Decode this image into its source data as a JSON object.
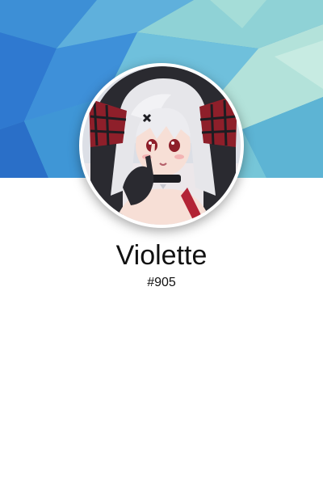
{
  "profile": {
    "display_name": "Violette",
    "tag": "#905"
  },
  "banner": {
    "style": "low-poly-abstract",
    "colors": [
      "#2f79d0",
      "#3d94d8",
      "#6fc0dc",
      "#93d6d3",
      "#b8e4dc",
      "#4aa3d6"
    ]
  },
  "avatar": {
    "subject": "anime-character-portrait",
    "colors": {
      "hair": "#e6e6ea",
      "accent": "#8e1f2a",
      "skin": "#f7dfd6",
      "dark": "#1d1d22"
    }
  }
}
